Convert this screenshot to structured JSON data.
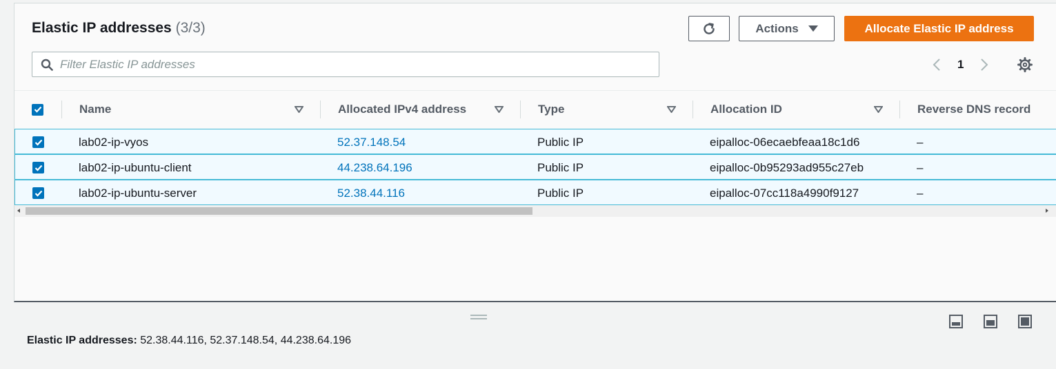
{
  "panel": {
    "title": "Elastic IP addresses",
    "count": "(3/3)",
    "actions_label": "Actions",
    "allocate_label": "Allocate Elastic IP address",
    "filter_placeholder": "Filter Elastic IP addresses",
    "page": "1"
  },
  "table": {
    "columns": [
      "Name",
      "Allocated IPv4 address",
      "Type",
      "Allocation ID",
      "Reverse DNS record"
    ],
    "rows": [
      {
        "name": "lab02-ip-vyos",
        "ip": "52.37.148.54",
        "type": "Public IP",
        "allocation_id": "eipalloc-06ecaebfeaa18c1d6",
        "reverse_dns": "–",
        "selected": true
      },
      {
        "name": "lab02-ip-ubuntu-client",
        "ip": "44.238.64.196",
        "type": "Public IP",
        "allocation_id": "eipalloc-0b95293ad955c27eb",
        "reverse_dns": "–",
        "selected": true
      },
      {
        "name": "lab02-ip-ubuntu-server",
        "ip": "52.38.44.116",
        "type": "Public IP",
        "allocation_id": "eipalloc-07cc118a4990f9127",
        "reverse_dns": "–",
        "selected": true
      }
    ]
  },
  "footer": {
    "label": "Elastic IP addresses:",
    "value": "52.38.44.116, 52.37.148.54, 44.238.64.196"
  },
  "colors": {
    "primary": "#ec7211",
    "link": "#0073bb",
    "selected_row_bg": "#f1faff",
    "selected_row_border": "#44b9d6"
  }
}
